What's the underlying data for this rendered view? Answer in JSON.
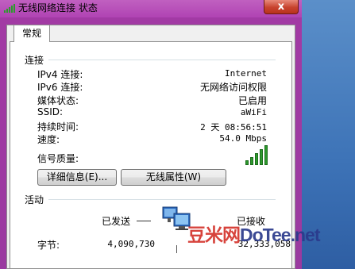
{
  "window": {
    "title": "无线网络连接 状态",
    "close_label": "x"
  },
  "tabs": [
    {
      "label": "常规"
    }
  ],
  "connection": {
    "title": "连接",
    "rows": [
      {
        "label": "IPv4 连接:",
        "value": "Internet"
      },
      {
        "label": "IPv6 连接:",
        "value": "无网络访问权限"
      },
      {
        "label": "媒体状态:",
        "value": "已启用"
      },
      {
        "label": "SSID:",
        "value": "aWiFi"
      },
      {
        "label": "持续时间:",
        "value": "2 天 08:56:51"
      },
      {
        "label": "速度:",
        "value": "54.0 Mbps"
      }
    ],
    "signal_label": "信号质量:",
    "signal_bars": 5
  },
  "buttons": {
    "details": "详细信息(E)...",
    "wireless_props": "无线属性(W)"
  },
  "activity": {
    "title": "活动",
    "sent_label": "已发送",
    "received_label": "已接收",
    "bytes_label": "字节:",
    "bytes_sent": "4,090,730",
    "bytes_received": "32,333,058"
  },
  "watermark": {
    "cn": "豆米网",
    "en": "DoTee.net"
  },
  "colors": {
    "signal": "#2c9a2c",
    "titlebar": "#b043b3",
    "close": "#c7432e"
  }
}
